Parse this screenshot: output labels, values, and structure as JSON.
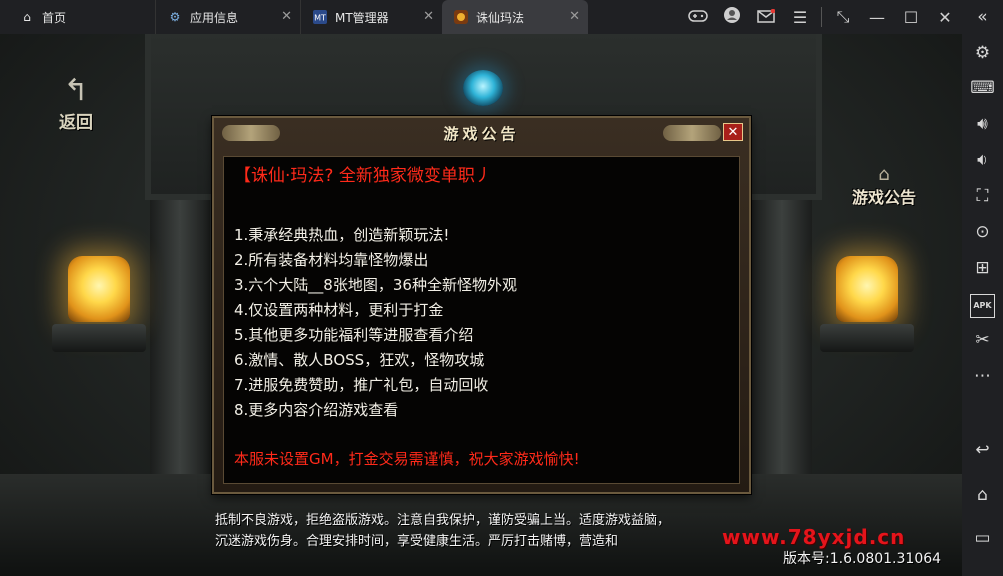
{
  "tabs": [
    {
      "label": "首页",
      "icon": "home-icon"
    },
    {
      "label": "应用信息",
      "icon": "gear-icon"
    },
    {
      "label": "MT管理器",
      "icon": "mt-app-icon"
    },
    {
      "label": "诛仙玛法",
      "icon": "game-app-icon"
    }
  ],
  "window_controls": [
    "gamepad-icon",
    "user-avatar-icon",
    "mail-icon",
    "menu-icon",
    "shrink-icon",
    "minimize-icon",
    "maximize-icon",
    "close-icon",
    "collapse-sidebar-icon"
  ],
  "sidebar_tools": [
    "settings-icon",
    "keyboard-icon",
    "volume-up-icon",
    "volume-down-icon",
    "screenshot-icon",
    "record-icon",
    "add-app-icon",
    "apk-install-icon",
    "scissors-icon",
    "more-icon",
    "back-icon",
    "home-icon",
    "recent-apps-icon"
  ],
  "sidebar_apk_label": "APK",
  "game": {
    "back_label": "返回",
    "notice_button_label": "游戏公告"
  },
  "dialog": {
    "title": "游戏公告",
    "close_symbol": "✕",
    "headline": "【诛仙·玛法? 全新独家微变单职丿",
    "lines": [
      "1.秉承经典热血，创造新颖玩法!",
      "2.所有装备材料均靠怪物爆出",
      "3.六个大陆__8张地图，36种全新怪物外观",
      "4.仅设置两种材料，更利于打金",
      "5.其他更多功能福利等进服查看介绍",
      "6.激情、散人BOSS，狂欢，怪物攻城",
      "7.进服免费赞助，推广礼包，自动回收",
      "8.更多内容介绍游戏查看"
    ],
    "warning": "本服未设置GM，打金交易需谨慎，祝大家游戏愉快!"
  },
  "footer": {
    "line1": "抵制不良游戏，拒绝盗版游戏。注意自我保护，谨防受骗上当。适度游戏益脑，",
    "line2": "沉迷游戏伤身。合理安排时间，享受健康生活。严厉打击赌博，营造和",
    "watermark": "www.78yxjd.cn",
    "version": "版本号:1.6.0801.31064"
  },
  "colors": {
    "accent_red": "#ff2a1a",
    "frame_bg": "#1f2023",
    "active_tab": "#3a3b3f"
  }
}
